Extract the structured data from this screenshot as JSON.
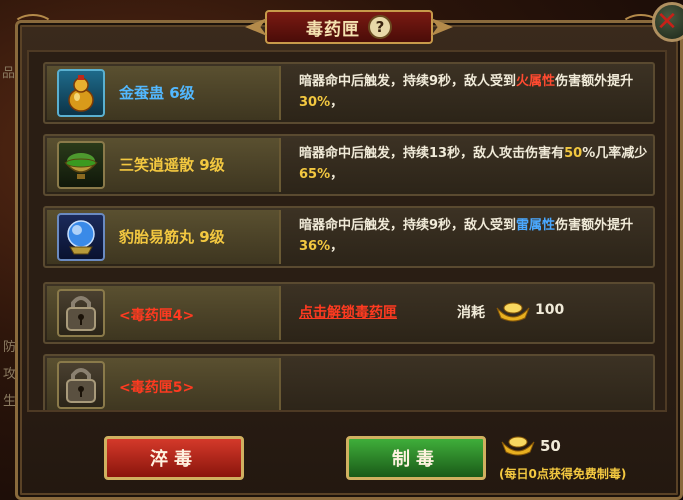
{
  "dialog": {
    "title": "毒药匣",
    "help_symbol": "?"
  },
  "background_text": [
    "品",
    "防",
    "攻",
    "生"
  ],
  "items": [
    {
      "name": "金蚕蛊  6级",
      "name_color": "#52b8ff",
      "icon": "golden-gourd-icon",
      "desc_parts": [
        {
          "text": "暗器命中后触发，持续9秒，敌人受到",
          "style": "normal"
        },
        {
          "text": "火属性",
          "style": "red"
        },
        {
          "text": "伤害额外提升",
          "style": "normal"
        },
        {
          "text": "30%",
          "style": "yellow"
        },
        {
          "text": "，",
          "style": "normal"
        }
      ]
    },
    {
      "name": "三笑逍遥散  9级",
      "name_color": "#f3c840",
      "icon": "green-bowl-icon",
      "desc_parts": [
        {
          "text": "暗器命中后触发，持续13秒，敌人攻击伤害有",
          "style": "normal"
        },
        {
          "text": "50",
          "style": "yellow"
        },
        {
          "text": "%几率减少",
          "style": "normal"
        },
        {
          "text": "65%",
          "style": "yellow"
        },
        {
          "text": "，",
          "style": "normal"
        }
      ]
    },
    {
      "name": "豹胎易筋丸  9级",
      "name_color": "#f3c840",
      "icon": "blue-orb-icon",
      "desc_parts": [
        {
          "text": "暗器命中后触发，持续9秒，敌人受到",
          "style": "normal"
        },
        {
          "text": "雷属性",
          "style": "blue"
        },
        {
          "text": "伤害额外提升",
          "style": "normal"
        },
        {
          "text": "36%",
          "style": "yellow"
        },
        {
          "text": "，",
          "style": "normal"
        }
      ]
    }
  ],
  "locked_slots": [
    {
      "name": "<毒药匣4>",
      "unlock_text": "点击解锁毒药匣",
      "consume_label": "消耗",
      "consume_value": "100"
    },
    {
      "name": "<毒药匣5>"
    }
  ],
  "buttons": {
    "refine": "淬毒",
    "make_poison": "制毒"
  },
  "stock": {
    "value": "50",
    "note": "(每日0点获得免费制毒)"
  },
  "colors": {
    "accent_gold": "#f3c840",
    "fire_red": "#ff4a30",
    "thunder_blue": "#4aa8ff",
    "locked_red": "#ff3a20"
  }
}
